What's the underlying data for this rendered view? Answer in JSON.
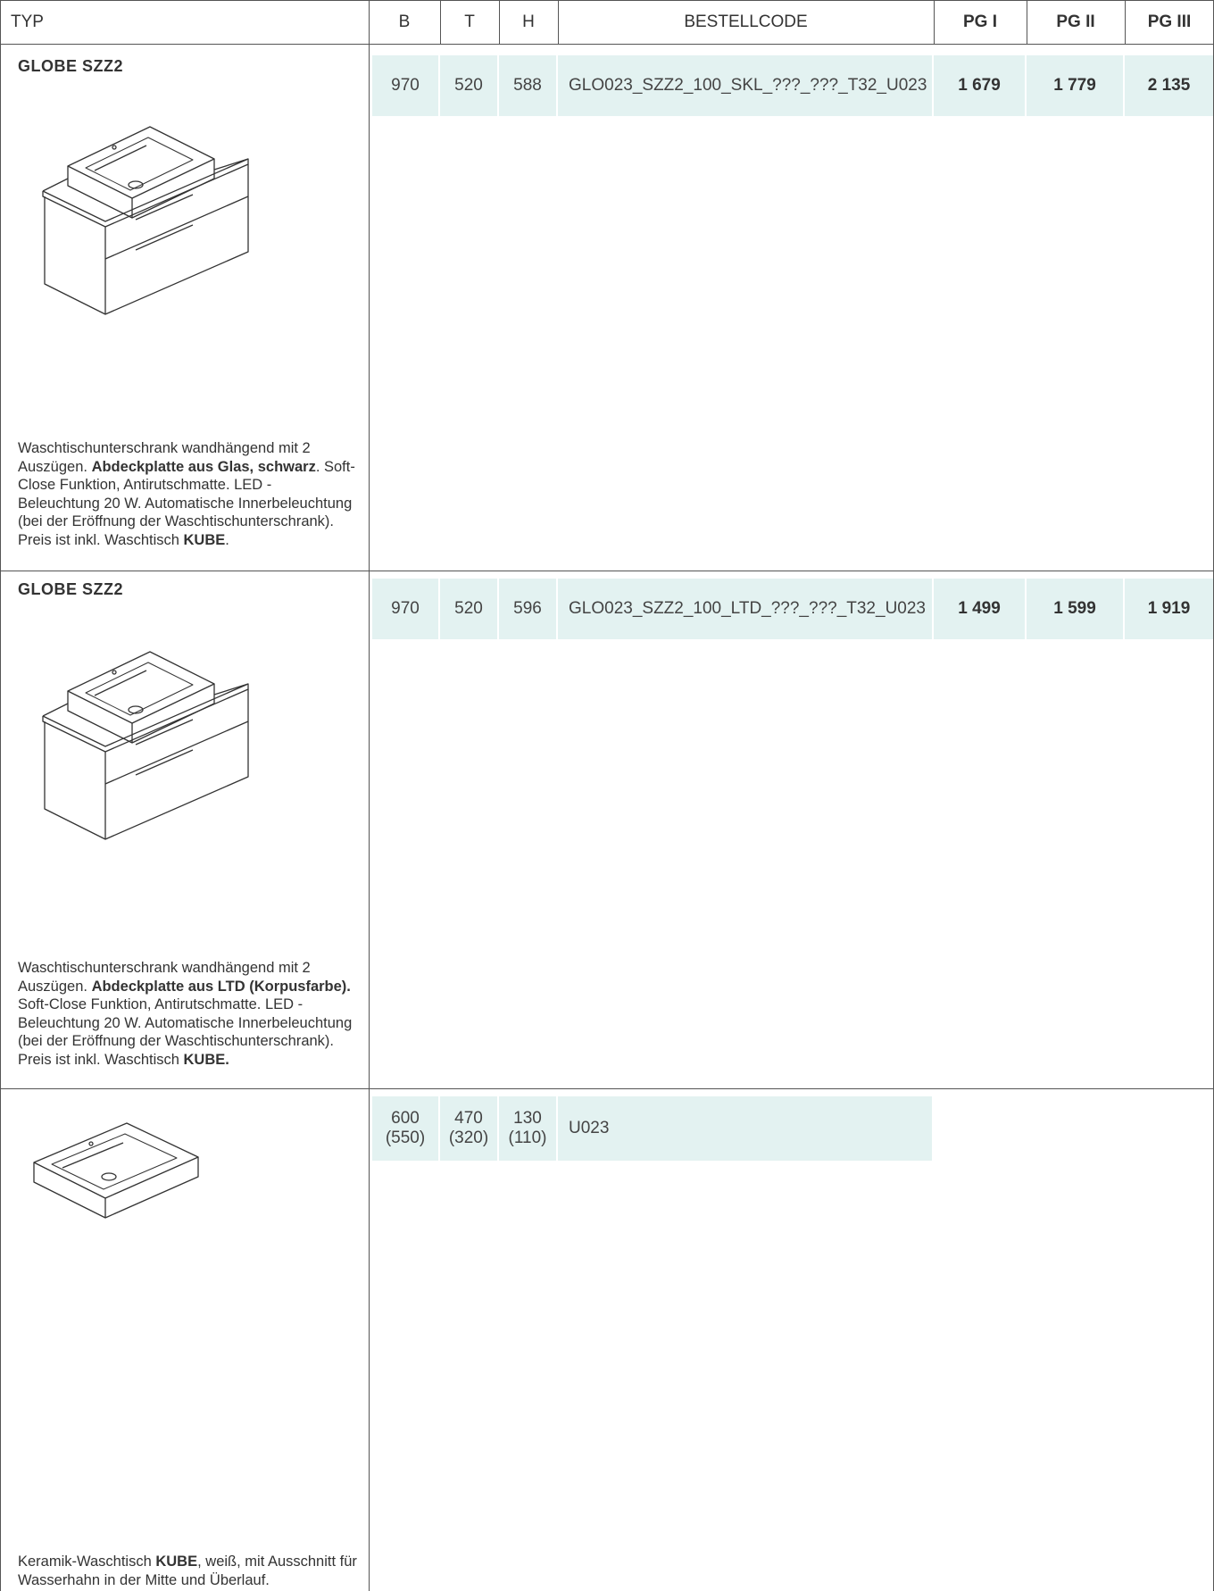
{
  "header": {
    "typ": "TYP",
    "b": "B",
    "t": "T",
    "h": "H",
    "code": "BESTELLCODE",
    "pg1": "PG I",
    "pg2": "PG II",
    "pg3": "PG III"
  },
  "rows": [
    {
      "title": "GLOBE SZZ2",
      "illustration": "vanity-unit-with-basin-icon",
      "desc": {
        "p1": "Waschtischunterschrank wandhängend mit 2 Auszügen. ",
        "b1": "Abdeckplatte aus Glas, schwarz",
        "p2": ". Soft-Close Funktion, Antirutschmatte. LED - Beleuchtung 20 W. Automatische Innerbeleuchtung (bei der Eröffnung der Waschtischunterschrank). Preis ist inkl. Waschtisch ",
        "b2": "KUBE",
        "p3": "."
      },
      "b": "970",
      "t": "520",
      "h": "588",
      "code": "GLO023_SZZ2_100_SKL_???_???_T32_U023",
      "pg1": "1 679",
      "pg2": "1 779",
      "pg3": "2 135"
    },
    {
      "title": "GLOBE SZZ2",
      "illustration": "vanity-unit-with-basin-icon",
      "desc": {
        "p1": "Waschtischunterschrank wandhängend mit 2 Auszügen. ",
        "b1": "Abdeckplatte aus LTD (Korpusfarbe).",
        "p2": " Soft-Close Funktion, Antirutschmatte. LED - Beleuchtung 20 W. Automatische Innerbeleuchtung (bei der Eröffnung der Waschtischunterschrank). Preis ist inkl. Waschtisch ",
        "b2": "KUBE.",
        "p3": ""
      },
      "b": "970",
      "t": "520",
      "h": "596",
      "code": "GLO023_SZZ2_100_LTD_???_???_T32_U023",
      "pg1": "1 499",
      "pg2": "1 599",
      "pg3": "1 919"
    },
    {
      "title": "",
      "illustration": "basin-icon",
      "desc": {
        "p1": "Keramik-Waschtisch ",
        "b1": "KUBE",
        "p2": ", weiß, mit Ausschnitt für Wasserhahn in der Mitte und Überlauf.",
        "b2": "",
        "p3": ""
      },
      "b": "600",
      "b2": "(550)",
      "t": "470",
      "t2": "(320)",
      "h": "130",
      "h2": "(110)",
      "code": "U023"
    }
  ]
}
